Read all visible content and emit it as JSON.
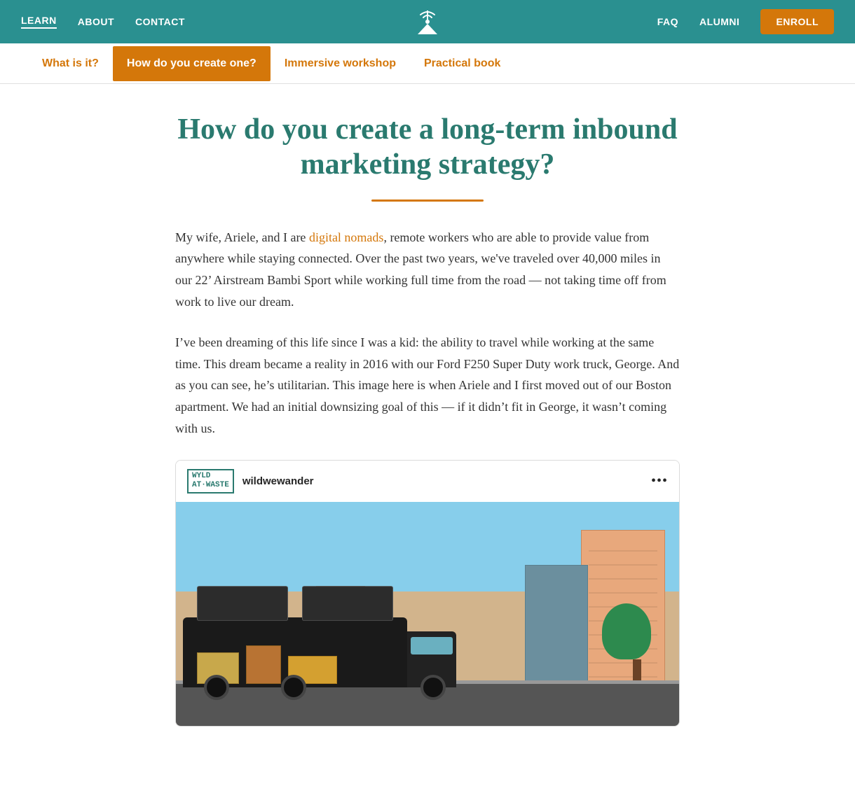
{
  "topNav": {
    "links": [
      {
        "label": "LEARN",
        "href": "#",
        "active": true
      },
      {
        "label": "ABOUT",
        "href": "#",
        "active": false
      },
      {
        "label": "CONTACT",
        "href": "#",
        "active": false
      }
    ],
    "rightLinks": [
      {
        "label": "FAQ",
        "href": "#"
      },
      {
        "label": "ALUMNI",
        "href": "#"
      }
    ],
    "enrollLabel": "ENROLL",
    "logoAlt": "site-logo"
  },
  "subNav": {
    "tabs": [
      {
        "label": "What is it?",
        "active": false
      },
      {
        "label": "How do you create one?",
        "active": true
      },
      {
        "label": "Immersive workshop",
        "active": false
      },
      {
        "label": "Practical book",
        "active": false
      }
    ]
  },
  "page": {
    "title": "How do you create a long-term inbound marketing strategy?",
    "divider": true,
    "paragraphs": [
      {
        "id": "p1",
        "linkText": "digital nomads",
        "beforeLink": "My wife, Ariele, and I are ",
        "afterLink": ", remote workers who are able to provide value from anywhere while staying connected. Over the past two years, we've traveled over 40,000 miles in our 22’ Airstream Bambi Sport while working full time from the road — not taking time off from work to live our dream."
      },
      {
        "id": "p2",
        "text": "I’ve been dreaming of this life since I was a kid: the ability to travel while working at the same time. This dream became a reality in 2016 with our Ford F250 Super Duty work truck, George. And as you can see, he’s utilitarian. This image here is when Ariele and I first moved out of our Boston apartment. We had an initial downsizing goal of this — if it didn’t fit in George, it wasn’t coming with us."
      }
    ],
    "instagram": {
      "logoText": "WYLD\nAT·WASTE",
      "username": "wildwewander",
      "dotsLabel": "•••"
    }
  }
}
